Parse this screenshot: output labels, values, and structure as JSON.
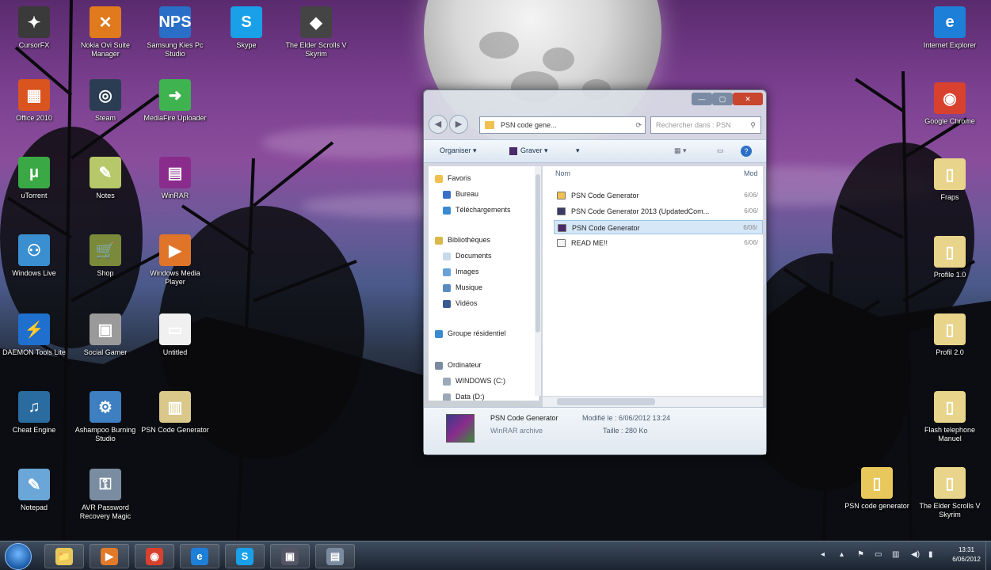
{
  "desktop": {
    "icons_left": [
      {
        "label": "CursorFX",
        "glyph": "✦",
        "color": "#3a3a3a"
      },
      {
        "label": "Nokia Ovi Suite Manager",
        "glyph": "✕",
        "color": "#e07a1c"
      },
      {
        "label": "Samsung Kies Pc Studio",
        "glyph": "NPS",
        "color": "#2a6fc7"
      },
      {
        "label": "Skype",
        "glyph": "S",
        "color": "#1aa0e8"
      },
      {
        "label": "The Elder Scrolls V Skyrim",
        "glyph": "◆",
        "color": "#444"
      },
      {
        "label": "Office 2010",
        "glyph": "▦",
        "color": "#d9541e"
      },
      {
        "label": "Steam",
        "glyph": "◎",
        "color": "#2b3d52"
      },
      {
        "label": "MediaFire Uploader",
        "glyph": "➜",
        "color": "#3fb34f"
      },
      {
        "label": "uTorrent",
        "glyph": "μ",
        "color": "#3aa845"
      },
      {
        "label": "Notes",
        "glyph": "✎",
        "color": "#b7c86a"
      },
      {
        "label": "WinRAR",
        "glyph": "▤",
        "color": "#8a2c8c"
      },
      {
        "label": "Windows Live",
        "glyph": "⚇",
        "color": "#3a8fd0"
      },
      {
        "label": "Shop",
        "glyph": "🛒",
        "color": "#7a8a3a"
      },
      {
        "label": "Windows Media Player",
        "glyph": "▶",
        "color": "#e0752a"
      },
      {
        "label": "DAEMON Tools Lite",
        "glyph": "⚡",
        "color": "#1f6fcf"
      },
      {
        "label": "Social Gamer",
        "glyph": "▣",
        "color": "#9a9a9a"
      },
      {
        "label": "Untitled",
        "glyph": "▭",
        "color": "#f0f0f0"
      },
      {
        "label": "Cheat Engine",
        "glyph": "♫",
        "color": "#2a6ca0"
      },
      {
        "label": "Ashampoo Burning Studio",
        "glyph": "⚙",
        "color": "#3d7fc0"
      },
      {
        "label": "PSN Code Generator",
        "glyph": "▥",
        "color": "#d9c88a"
      },
      {
        "label": "Notepad",
        "glyph": "✎",
        "color": "#6aa7d8"
      },
      {
        "label": "AVR Password Recovery Magic",
        "glyph": "⚿",
        "color": "#7a8ca0"
      }
    ],
    "icons_right": [
      {
        "label": "Internet Explorer",
        "glyph": "e",
        "color": "#1e7fd8"
      },
      {
        "label": "Google Chrome",
        "glyph": "◉",
        "color": "#d8412e"
      },
      {
        "label": "Fraps",
        "glyph": "▯",
        "color": "#e8d48a"
      },
      {
        "label": "Profile 1.0",
        "glyph": "▯",
        "color": "#e8d48a"
      },
      {
        "label": "Profil 2.0",
        "glyph": "▯",
        "color": "#e8d48a"
      },
      {
        "label": "Flash telephone Manuel",
        "glyph": "▯",
        "color": "#e8d48a"
      },
      {
        "label": "PSN code generator",
        "glyph": "▯",
        "color": "#e8c85a"
      },
      {
        "label": "The Elder Scrolls V Skyrim",
        "glyph": "▯",
        "color": "#e8d48a"
      }
    ]
  },
  "explorer": {
    "address": "PSN code gene...",
    "search_placeholder": "Rechercher dans : PSN",
    "toolbar": {
      "organize": "Organiser ▾",
      "share": "Graver ▾",
      "newfolder": "▾"
    },
    "nav": [
      {
        "label": "Favoris",
        "color": "#f0c050"
      },
      {
        "label": "Bureau",
        "color": "#3a6fc7"
      },
      {
        "label": "Téléchargements",
        "color": "#3a8ad0"
      },
      {
        "label": "Bibliothèques",
        "color": "#d9b84a"
      },
      {
        "label": "Documents",
        "color": "#c9d8ea"
      },
      {
        "label": "Images",
        "color": "#6aa0d8"
      },
      {
        "label": "Musique",
        "color": "#5a8ac0"
      },
      {
        "label": "Vidéos",
        "color": "#3a5a90"
      },
      {
        "label": "Groupe résidentiel",
        "color": "#3a8ad0"
      },
      {
        "label": "Ordinateur",
        "color": "#7a8aa0"
      },
      {
        "label": "WINDOWS (C:)",
        "color": "#9aa8b8"
      },
      {
        "label": "Data (D:)",
        "color": "#9aa8b8"
      }
    ],
    "columns": {
      "name": "Nom",
      "modified": "Mod"
    },
    "files": [
      {
        "name": "PSN Code Generator",
        "date": "6/06/",
        "color": "#f0c050"
      },
      {
        "name": "PSN Code Generator 2013 (UpdatedCom...",
        "date": "6/06/",
        "color": "#3a3a6a"
      },
      {
        "name": "PSN Code Generator",
        "date": "6/06/",
        "color": "#4a2a6a"
      },
      {
        "name": "READ ME!!",
        "date": "6/06/",
        "color": "#f4f4f4"
      }
    ],
    "details": {
      "name": "PSN Code Generator",
      "modified": "Modifié le : 6/06/2012 13:24",
      "type": "WinRAR archive",
      "size": "Taille : 280 Ko"
    }
  },
  "taskbar": {
    "apps": [
      {
        "name": "explorer-button",
        "glyph": "📁",
        "color": "#e8c85a"
      },
      {
        "name": "media-player-button",
        "glyph": "▶",
        "color": "#e07a2a"
      },
      {
        "name": "chrome-button",
        "glyph": "◉",
        "color": "#d8412e"
      },
      {
        "name": "ie-button",
        "glyph": "e",
        "color": "#1e7fd8"
      },
      {
        "name": "skype-button",
        "glyph": "S",
        "color": "#1aa0e8"
      },
      {
        "name": "task-button-1",
        "glyph": "▣",
        "color": "#556"
      },
      {
        "name": "task-button-2",
        "glyph": "▤",
        "color": "#7a8aa0"
      }
    ],
    "clock": {
      "time": "13:31",
      "date": "6/06/2012"
    }
  }
}
